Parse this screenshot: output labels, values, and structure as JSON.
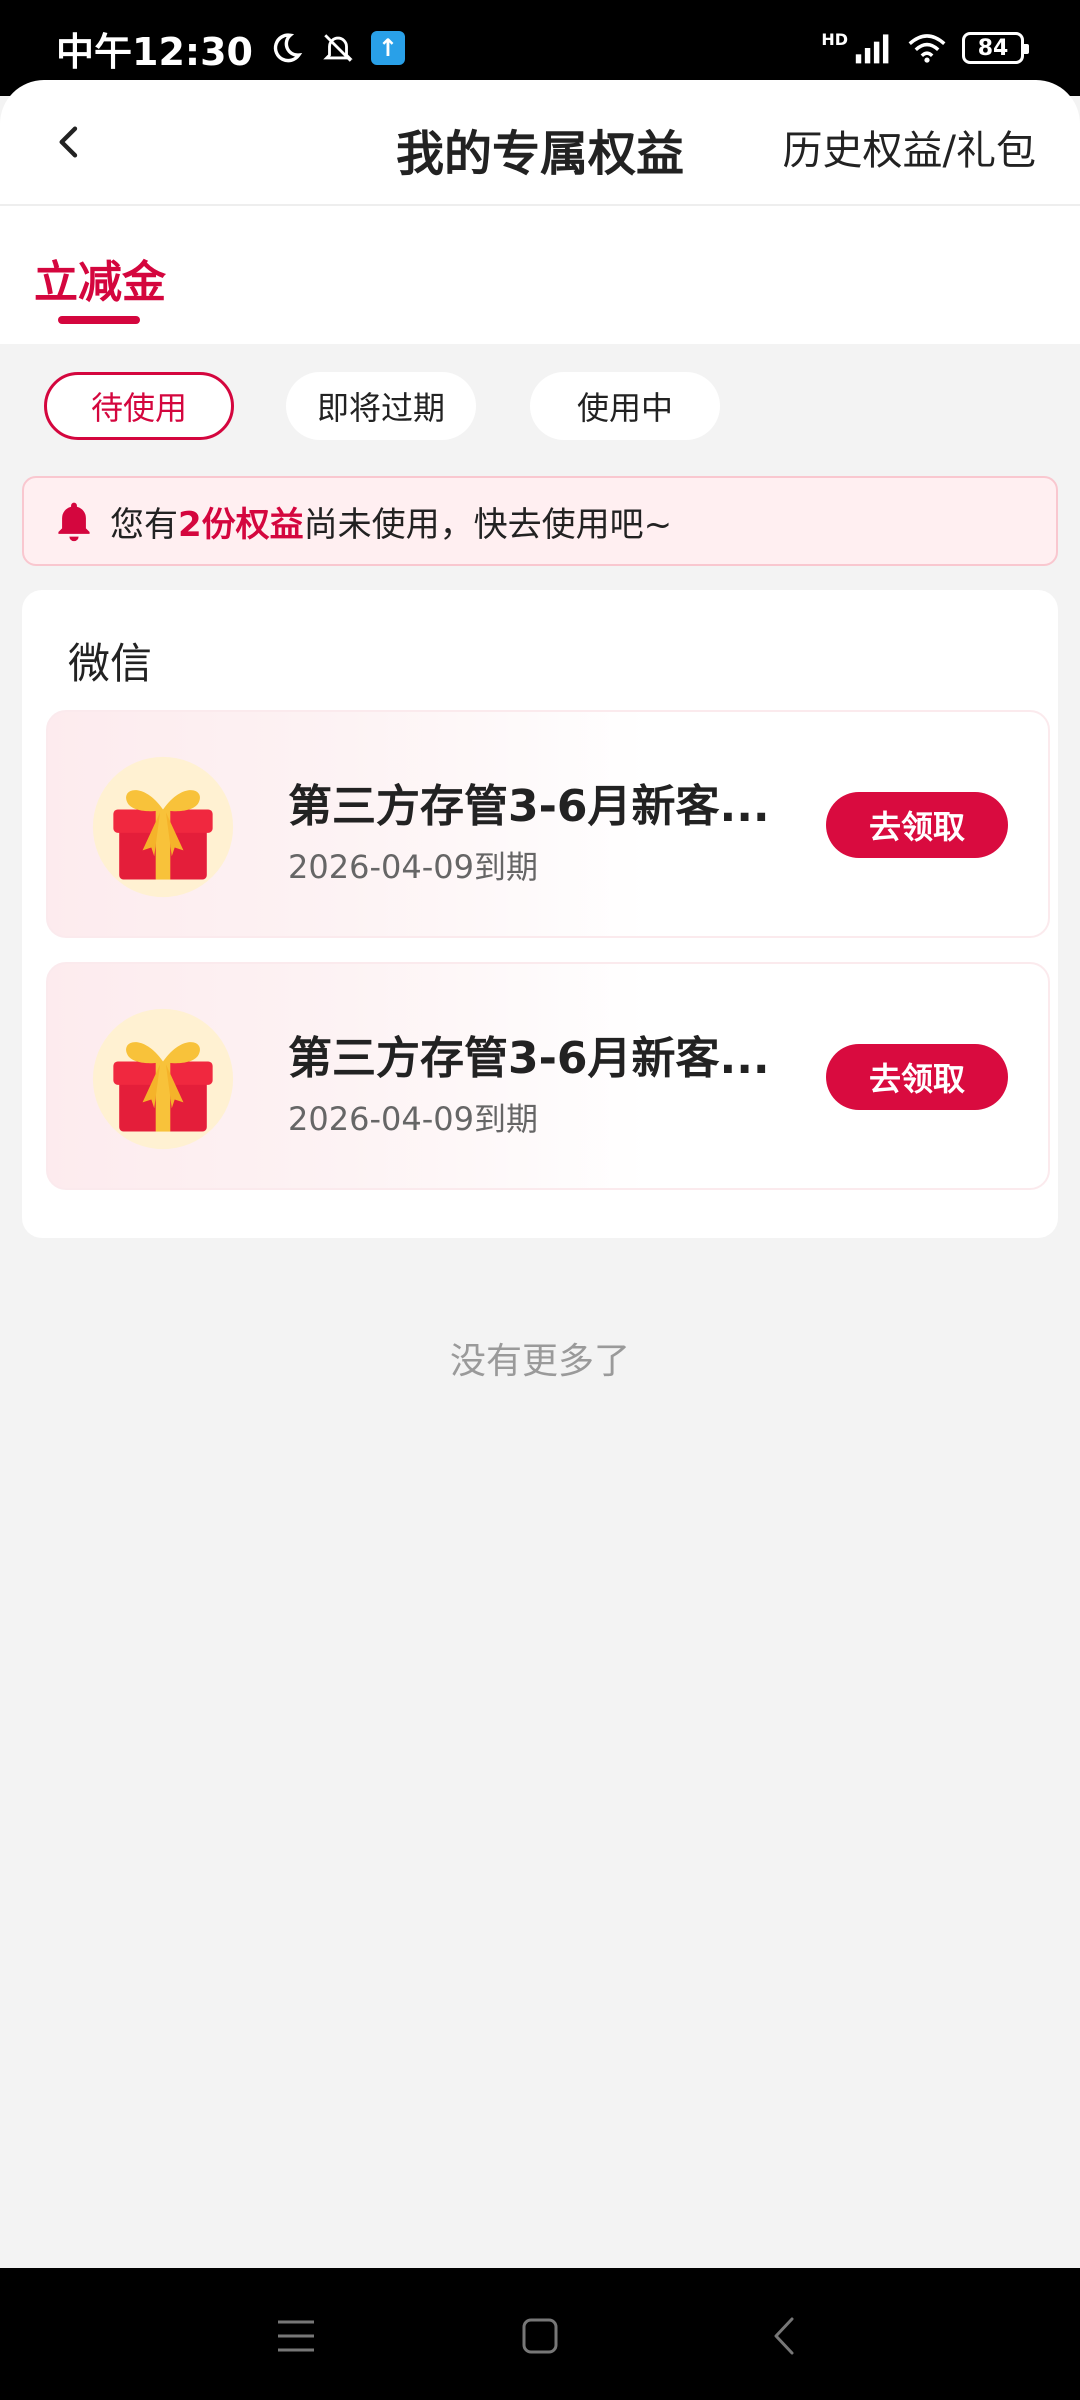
{
  "status_bar": {
    "time": "中午12:30",
    "network_label": "HD",
    "battery": "84"
  },
  "header": {
    "title": "我的专属权益",
    "history_link": "历史权益/礼包"
  },
  "tabs": [
    {
      "label": "立减金",
      "active": true
    }
  ],
  "filters": [
    {
      "label": "待使用",
      "active": true
    },
    {
      "label": "即将过期",
      "active": false
    },
    {
      "label": "使用中",
      "active": false
    }
  ],
  "notice": {
    "prefix": "您有",
    "highlight": "2份权益",
    "suffix": "尚未使用，快去使用吧~"
  },
  "card": {
    "title": "微信",
    "items": [
      {
        "name": "第三方存管3-6月新客...",
        "expiry": "2026-04-09到期",
        "action": "去领取"
      },
      {
        "name": "第三方存管3-6月新客...",
        "expiry": "2026-04-09到期",
        "action": "去领取"
      }
    ]
  },
  "footer": {
    "no_more": "没有更多了"
  },
  "colors": {
    "accent": "#d4063e",
    "button": "#d90b3f",
    "background": "#f3f3f3"
  },
  "icons": [
    "moon-icon",
    "bell-off-icon",
    "upload-icon",
    "signal-icon",
    "wifi-icon",
    "battery-icon",
    "back-arrow-icon",
    "bell-icon",
    "gift-icon",
    "menu-icon",
    "home-icon",
    "nav-back-icon"
  ]
}
